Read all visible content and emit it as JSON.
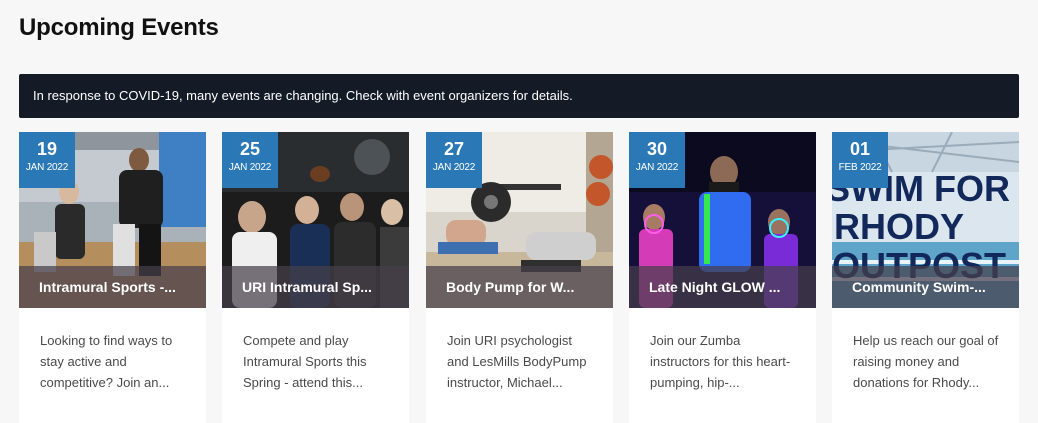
{
  "page": {
    "title": "Upcoming Events",
    "notice": "In response to COVID-19, many events are changing. Check with event organizers for details."
  },
  "events": [
    {
      "day": "19",
      "month": "JAN 2022",
      "title": "Intramural Sports -...",
      "description": "Looking to find ways to stay active and competitive? Join an..."
    },
    {
      "day": "25",
      "month": "JAN 2022",
      "title": "URI Intramural Sp...",
      "description": "Compete and play Intramural Sports this Spring - attend this..."
    },
    {
      "day": "27",
      "month": "JAN 2022",
      "title": "Body Pump for W...",
      "description": "Join URI psychologist and LesMills BodyPump instructor, Michael..."
    },
    {
      "day": "30",
      "month": "JAN 2022",
      "title": "Late Night GLOW ...",
      "description": "Join our Zumba instructors for this heart-pumping, hip-..."
    },
    {
      "day": "01",
      "month": "FEB 2022",
      "title": "Community Swim-...",
      "description": "Help us reach our goal of raising money and donations for Rhody...",
      "image_text": [
        "SWIM FOR",
        "RHODY",
        "OUTPOST"
      ]
    }
  ],
  "colors": {
    "badge": "#2a78b5",
    "notice_bg": "#141b27"
  }
}
